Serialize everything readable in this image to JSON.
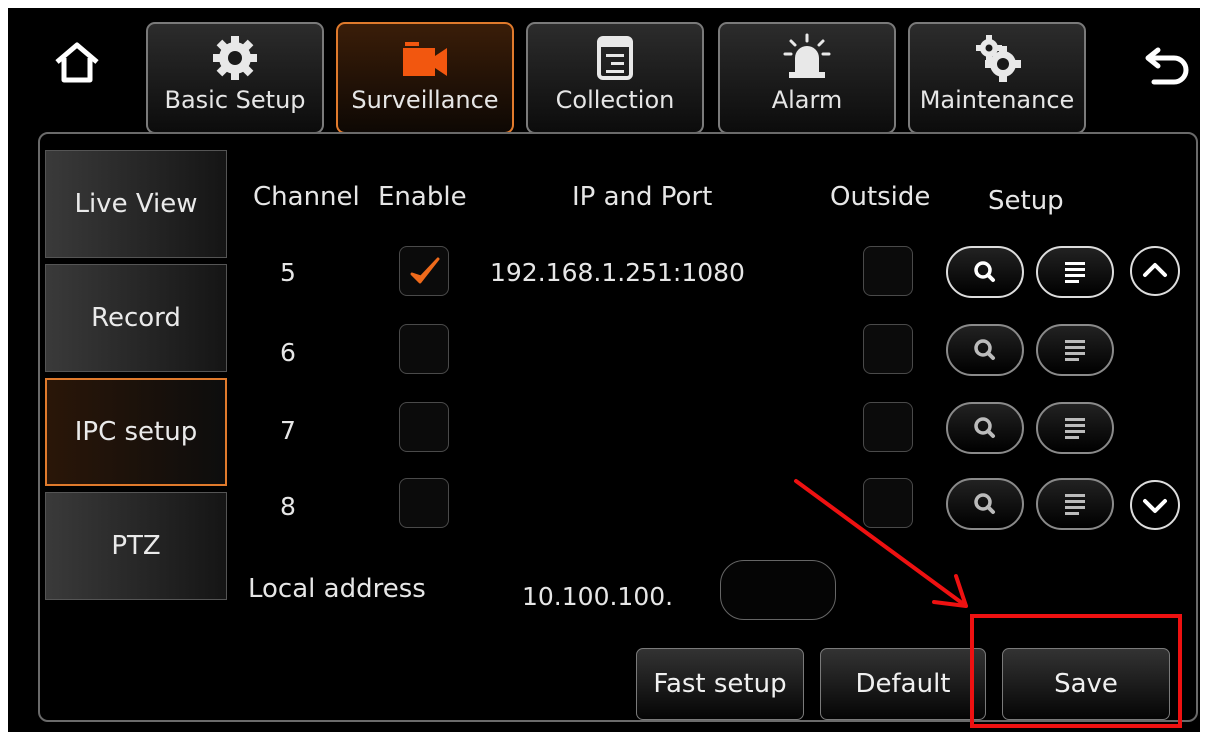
{
  "nav": {
    "tabs": [
      {
        "label": "Basic Setup",
        "icon": "gear-icon"
      },
      {
        "label": "Surveillance",
        "icon": "camera-icon"
      },
      {
        "label": "Collection",
        "icon": "document-icon"
      },
      {
        "label": "Alarm",
        "icon": "alarm-light-icon"
      },
      {
        "label": "Maintenance",
        "icon": "gears-icon"
      }
    ],
    "active_tab": "Surveillance",
    "home_icon": "home-icon",
    "back_icon": "back-arrow-icon"
  },
  "sidebar": {
    "items": [
      {
        "label": "Live View"
      },
      {
        "label": "Record"
      },
      {
        "label": "IPC setup"
      },
      {
        "label": "PTZ"
      }
    ],
    "active": "IPC setup"
  },
  "table": {
    "headers": {
      "channel": "Channel",
      "enable": "Enable",
      "ip": "IP and Port",
      "outside": "Outside",
      "setup": "Setup"
    },
    "rows": [
      {
        "channel": "5",
        "enabled": true,
        "ip": "192.168.1.251:1080",
        "outside": false
      },
      {
        "channel": "6",
        "enabled": false,
        "ip": "",
        "outside": false
      },
      {
        "channel": "7",
        "enabled": false,
        "ip": "",
        "outside": false
      },
      {
        "channel": "8",
        "enabled": false,
        "ip": "",
        "outside": false
      }
    ]
  },
  "local": {
    "label": "Local address",
    "prefix": "10.100.100.",
    "value": ""
  },
  "buttons": {
    "fast_setup": "Fast setup",
    "default": "Default",
    "save": "Save"
  },
  "colors": {
    "accent": "#e07a2c",
    "annotation": "#e11111"
  }
}
